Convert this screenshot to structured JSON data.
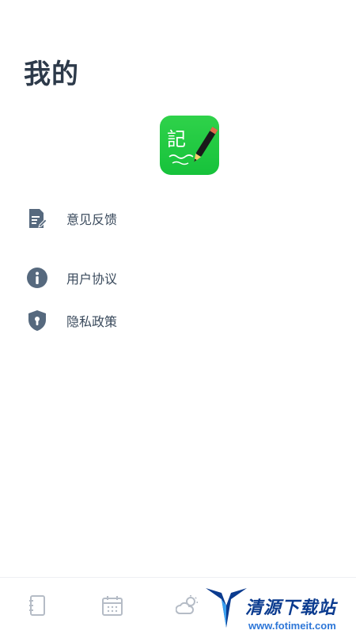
{
  "header": {
    "title": "我的"
  },
  "logo": {
    "char": "記",
    "name": "app-logo"
  },
  "menu": {
    "items": [
      {
        "label": "意见反馈",
        "icon": "feedback-document-icon"
      },
      {
        "label": "用户协议",
        "icon": "info-circle-icon"
      },
      {
        "label": "隐私政策",
        "icon": "shield-lock-icon"
      }
    ]
  },
  "tabbar": {
    "tabs": [
      {
        "icon": "notebook-icon"
      },
      {
        "icon": "calendar-icon"
      },
      {
        "icon": "weather-icon"
      },
      {
        "icon": "profile-icon"
      }
    ]
  },
  "watermark": {
    "title": "清源下载站",
    "url": "www.fotimeit.com"
  },
  "colors": {
    "title": "#2d3a4a",
    "icon": "#56697e",
    "logo_green": "#1ec840",
    "tab_icon": "#b5bcc6"
  }
}
